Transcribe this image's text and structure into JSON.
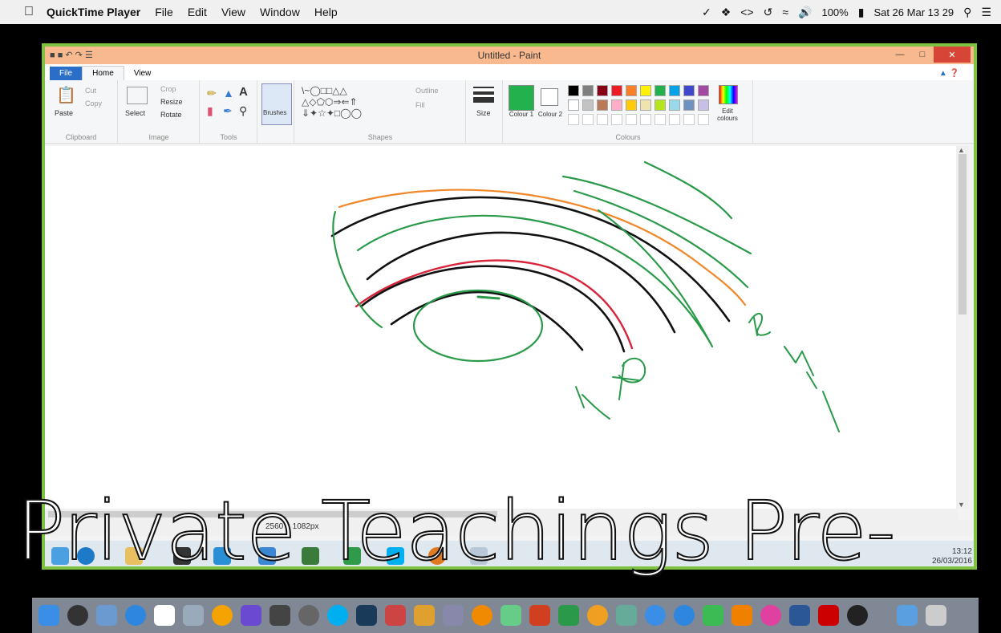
{
  "menubar": {
    "app_name": "QuickTime Player",
    "menus": [
      "File",
      "Edit",
      "View",
      "Window",
      "Help"
    ],
    "battery": "100%",
    "datetime": "Sat 26 Mar  13 29"
  },
  "paint": {
    "title": "Untitled - Paint",
    "tabs": {
      "file": "File",
      "home": "Home",
      "view": "View"
    },
    "clipboard": {
      "paste": "Paste",
      "cut": "Cut",
      "copy": "Copy",
      "label": "Clipboard"
    },
    "image": {
      "select": "Select",
      "crop": "Crop",
      "resize": "Resize",
      "rotate": "Rotate",
      "label": "Image"
    },
    "tools": {
      "label": "Tools"
    },
    "brushes": "Brushes",
    "shapes": {
      "outline": "Outline",
      "fill": "Fill",
      "label": "Shapes"
    },
    "size": "Size",
    "colours": {
      "colour1": "Colour 1",
      "colour2": "Colour 2",
      "edit": "Edit colours",
      "label": "Colours"
    },
    "palette_row1": [
      "#000000",
      "#7f7f7f",
      "#880015",
      "#ed1c24",
      "#ff7f27",
      "#fff200",
      "#22b14c",
      "#00a2e8",
      "#3f48cc",
      "#a349a4"
    ],
    "palette_row2": [
      "#ffffff",
      "#c3c3c3",
      "#b97a57",
      "#ffaec9",
      "#ffc90e",
      "#efe4b0",
      "#b5e61d",
      "#99d9ea",
      "#7092be",
      "#c8bfe7"
    ],
    "colour1_value": "#22b14c",
    "status_dims": "2560 × 1082px"
  },
  "taskbar": {
    "time": "13:12",
    "date": "26/03/2016"
  },
  "overlay_text": "Private Teachings Pre-"
}
